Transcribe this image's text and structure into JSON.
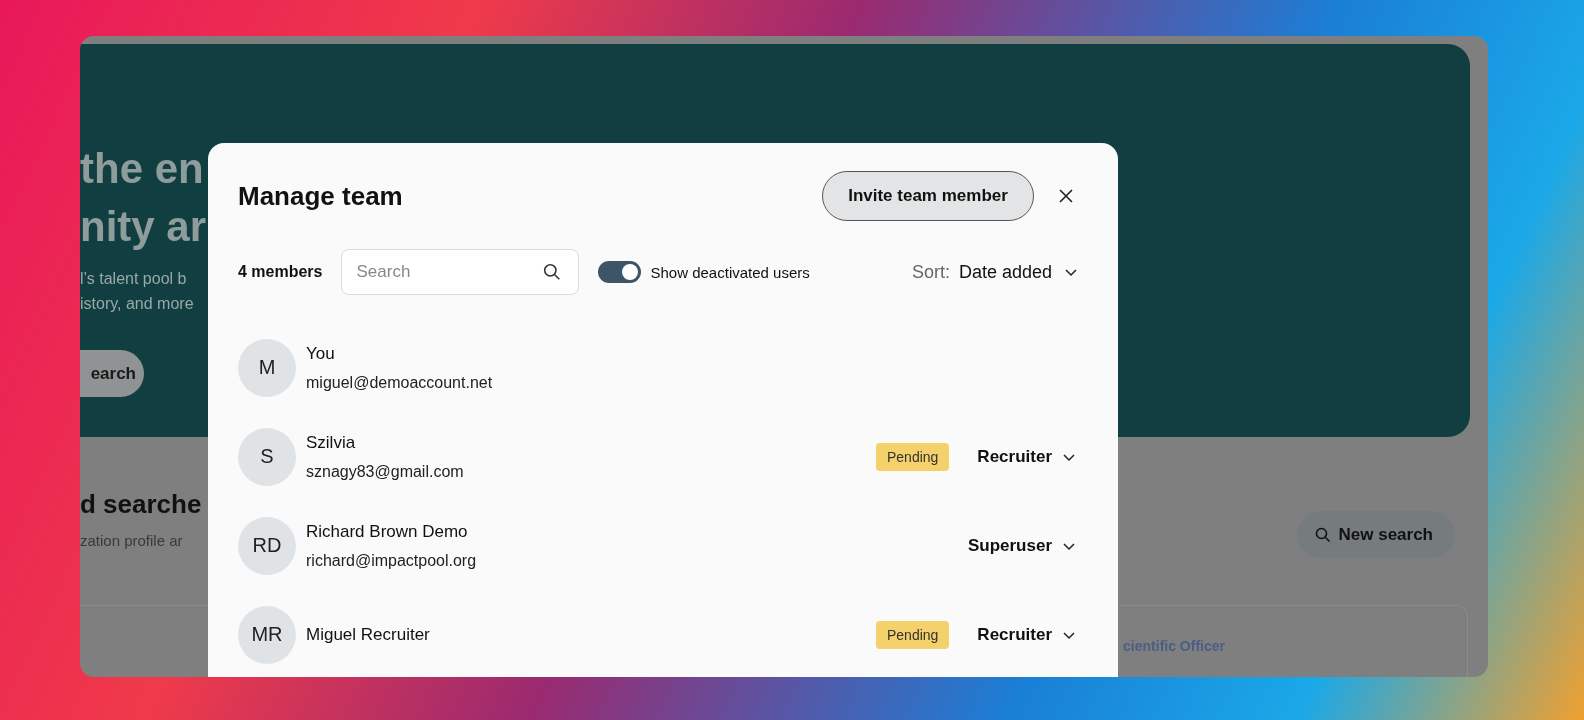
{
  "background_page": {
    "hero": {
      "heading_lines": [
        "the en",
        "nity ar"
      ],
      "subtitle_lines": [
        "l’s talent pool b",
        "istory, and more"
      ],
      "button": "earch"
    },
    "section": {
      "title": "d searche",
      "subtitle": "zation profile ar",
      "new_search_button": "New search",
      "card_text": "cientific Officer"
    }
  },
  "modal": {
    "title": "Manage team",
    "invite_button": "Invite team member",
    "member_count": "4 members",
    "search": {
      "placeholder": "Search"
    },
    "toggle": {
      "label": "Show deactivated users",
      "on": true
    },
    "sort": {
      "label": "Sort:",
      "value": "Date added"
    },
    "members": [
      {
        "initials": "M",
        "name": "You",
        "email": "miguel@demoaccount.net"
      },
      {
        "initials": "S",
        "name": "Szilvia",
        "email": "sznagy83@gmail.com",
        "badge": "Pending",
        "role": "Recruiter"
      },
      {
        "initials": "RD",
        "name": "Richard Brown Demo",
        "email": "richard@impactpool.org",
        "role": "Superuser"
      },
      {
        "initials": "MR",
        "name": "Miguel Recruiter",
        "badge": "Pending",
        "role": "Recruiter"
      }
    ]
  }
}
